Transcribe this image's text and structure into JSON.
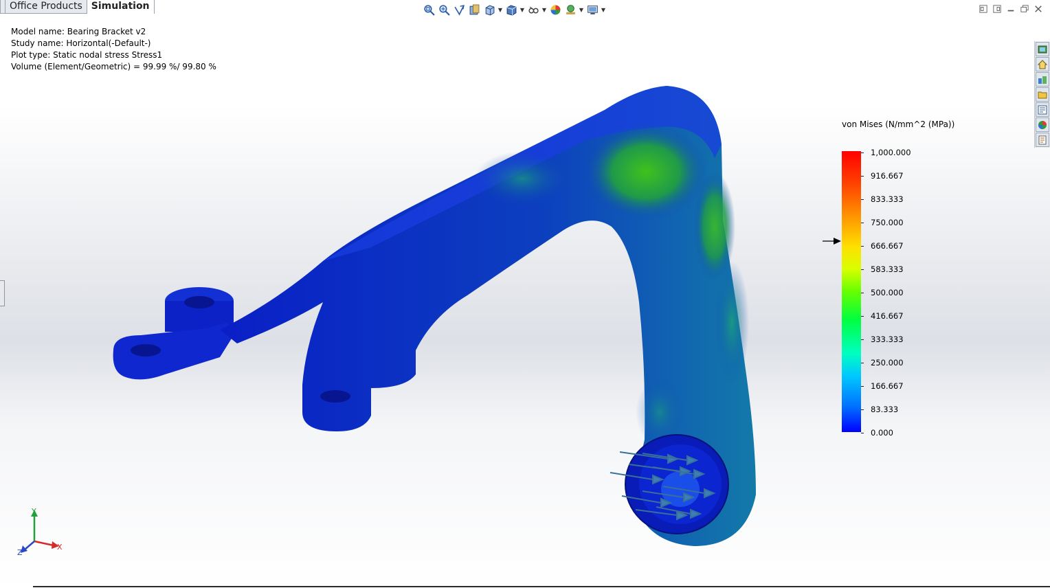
{
  "tabs": [
    {
      "label": ""
    },
    {
      "label": "Office Products"
    },
    {
      "label": "Simulation",
      "active": true
    }
  ],
  "info": {
    "model_name": "Model name: Bearing Bracket v2",
    "study_name": "Study name: Horizontal(-Default-)",
    "plot_type": "Plot type: Static nodal stress Stress1",
    "volume": "Volume (Element/Geometric) = 99.99 %/ 99.80 %"
  },
  "toolbar": {
    "icons": [
      "zoom-to-fit-icon",
      "zoom-to-area-icon",
      "previous-view-icon",
      "section-view-icon",
      "view-orientation-icon",
      "display-style-icon",
      "hide-show-items-icon",
      "edit-appearance-icon",
      "apply-scene-icon",
      "view-settings-icon"
    ]
  },
  "sidebar": {
    "icons": [
      "simulation-pane-icon",
      "home-icon",
      "design-library-icon",
      "file-explorer-icon",
      "view-palette-icon",
      "appearances-icon",
      "custom-properties-icon"
    ]
  },
  "legend": {
    "title": "von Mises (N/mm^2 (MPa))",
    "ticks": [
      "1,000.000",
      "916.667",
      "833.333",
      "750.000",
      "666.667",
      "583.333",
      "500.000",
      "416.667",
      "333.333",
      "250.000",
      "166.667",
      "83.333",
      "0.000"
    ],
    "min": 0,
    "max": 1000,
    "yield_marker": 666.667,
    "colors": {
      "low": "#0000ff",
      "mid": "#00ff40",
      "high": "#ff0000"
    }
  },
  "triad": {
    "x": "X",
    "y": "Y",
    "z": "Z"
  }
}
